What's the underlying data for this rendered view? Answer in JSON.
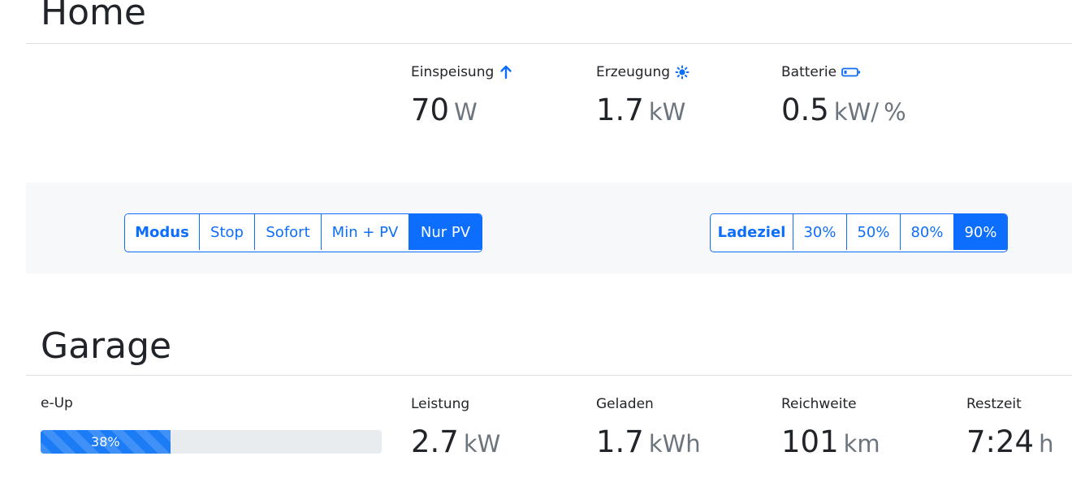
{
  "home": {
    "title": "Home",
    "metrics": {
      "feed": {
        "label": "Einspeisung",
        "icon": "arrow-up-icon",
        "value": "70",
        "unit": "W"
      },
      "production": {
        "label": "Erzeugung",
        "icon": "sun-icon",
        "value": "1.7",
        "unit": "kW"
      },
      "battery": {
        "label": "Batterie",
        "icon": "battery-icon",
        "value": "0.5",
        "unit": "kW/",
        "unit2": "%"
      }
    }
  },
  "controls": {
    "mode": {
      "label": "Modus",
      "options": [
        "Stop",
        "Sofort",
        "Min + PV",
        "Nur PV"
      ],
      "selected": "Nur PV"
    },
    "target": {
      "label": "Ladeziel",
      "options": [
        "30%",
        "50%",
        "80%",
        "90%"
      ],
      "selected": "90%"
    }
  },
  "garage": {
    "title": "Garage",
    "vehicle": {
      "name": "e-Up",
      "soc": 38,
      "soc_label": "38%"
    },
    "metrics": {
      "power": {
        "label": "Leistung",
        "value": "2.7",
        "unit": "kW"
      },
      "charged": {
        "label": "Geladen",
        "value": "1.7",
        "unit": "kWh"
      },
      "range": {
        "label": "Reichweite",
        "value": "101",
        "unit": "km"
      },
      "remaining": {
        "label": "Restzeit",
        "value": "7:24",
        "unit": "h"
      }
    }
  },
  "colors": {
    "accent": "#0d6efd",
    "muted": "#6c757d",
    "panel": "#f7f8fa"
  }
}
